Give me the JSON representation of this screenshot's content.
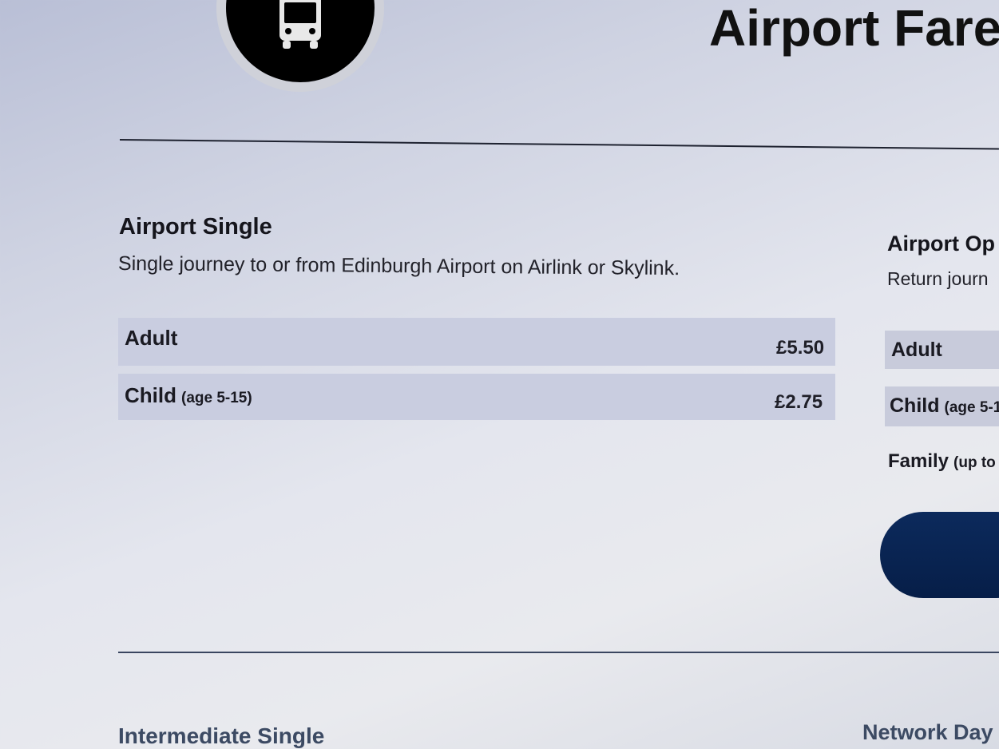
{
  "header": {
    "title": "Airport Fare",
    "logo_icon": "bus-icon"
  },
  "airport_single": {
    "title": "Airport Single",
    "description": "Single journey to or from Edinburgh Airport on Airlink or Skylink.",
    "fares": [
      {
        "label": "Adult",
        "note": "",
        "price": "£5.50"
      },
      {
        "label": "Child",
        "note": "(age 5-15)",
        "price": "£2.75"
      }
    ]
  },
  "airport_open": {
    "title": "Airport Op",
    "description": "Return journ",
    "fares": [
      {
        "label": "Adult",
        "note": ""
      },
      {
        "label": "Child",
        "note": "(age 5-1"
      },
      {
        "label": "Family",
        "note": "(up to"
      }
    ],
    "button_label": ""
  },
  "bottom": {
    "left_heading": "Intermediate Single",
    "right_heading": "Network Day"
  },
  "colors": {
    "row_background": "#c9cde0",
    "button": "#0a2452",
    "bottom_heading": "#3c4a63"
  }
}
